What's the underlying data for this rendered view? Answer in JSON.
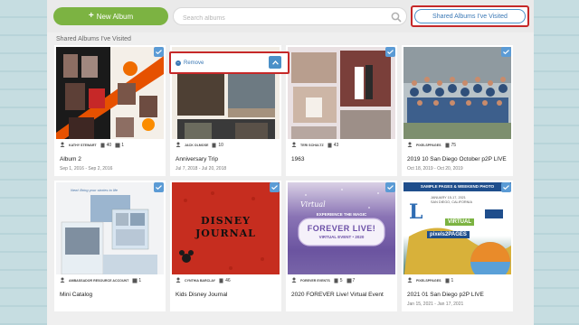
{
  "toolbar": {
    "new_album_label": "New Album",
    "search_placeholder": "Search albums",
    "shared_albums_label": "Shared Albums I've Visited"
  },
  "section": {
    "title": "Shared Albums I've Visited"
  },
  "remove_bar": {
    "label": "Remove"
  },
  "albums": [
    {
      "title": "Album 2",
      "dates": "Sep 1, 2016 - Sep 2, 2016",
      "owner": "KATHY STEWART",
      "pages": "40",
      "photos": "1"
    },
    {
      "title": "Anniversary Trip",
      "dates": "Jul 7, 2018 - Jul 20, 2018",
      "owner": "JACK OLMOSE",
      "pages": "10",
      "photos": ""
    },
    {
      "title": "1963",
      "dates": "",
      "owner": "TERI SCHULTZ",
      "pages": "43",
      "photos": ""
    },
    {
      "title": "2019 10 San Diego October p2P LIVE",
      "dates": "Oct 18, 2019 - Oct 20, 2019",
      "owner": "PIXELSPPAGES",
      "pages": "75",
      "photos": ""
    },
    {
      "title": "Mini Catalog",
      "dates": "",
      "owner": "AMBASSADOR RESOURCE ACCOUNT",
      "pages": "",
      "photos": "1"
    },
    {
      "title": "Kids Disney Journal",
      "dates": "",
      "owner": "CYNTHIA BARCLAY",
      "pages": "46",
      "photos": ""
    },
    {
      "title": "2020 FOREVER Live! Virtual Event",
      "dates": "",
      "owner": "FOREVER EVENTS",
      "pages": "5",
      "photos": "7"
    },
    {
      "title": "2021 01 San Diego p2P LIVE",
      "dates": "Jan 15, 2021 - Jan 17, 2021",
      "owner": "PIXELSPPAGES",
      "pages": "1",
      "photos": ""
    }
  ],
  "thumb_text": {
    "disney_line1": "DISNEY",
    "disney_line2": "JOURNAL",
    "virtual_word": "Virtual",
    "forever_tag": "EXPERIENCE THE MAGIC",
    "forever_title": "FOREVER LIVE!",
    "forever_sub": "VIRTUAL EVENT • 2020",
    "sd_header": "SAMPLE PAGES & WEEKEND PHOTO",
    "sd_dates": "JANUARY 15-17, 2021",
    "sd_city": "SAN DIEGO, CALIFORNIA",
    "sd_virtual": "VIRTUAL",
    "sd_brand": "pixels2PAGES",
    "mini_script": "New! Bring your stories to life"
  },
  "colors": {
    "accent_green": "#7cb342",
    "accent_blue": "#4a90c8",
    "highlight_red": "#c62828"
  }
}
